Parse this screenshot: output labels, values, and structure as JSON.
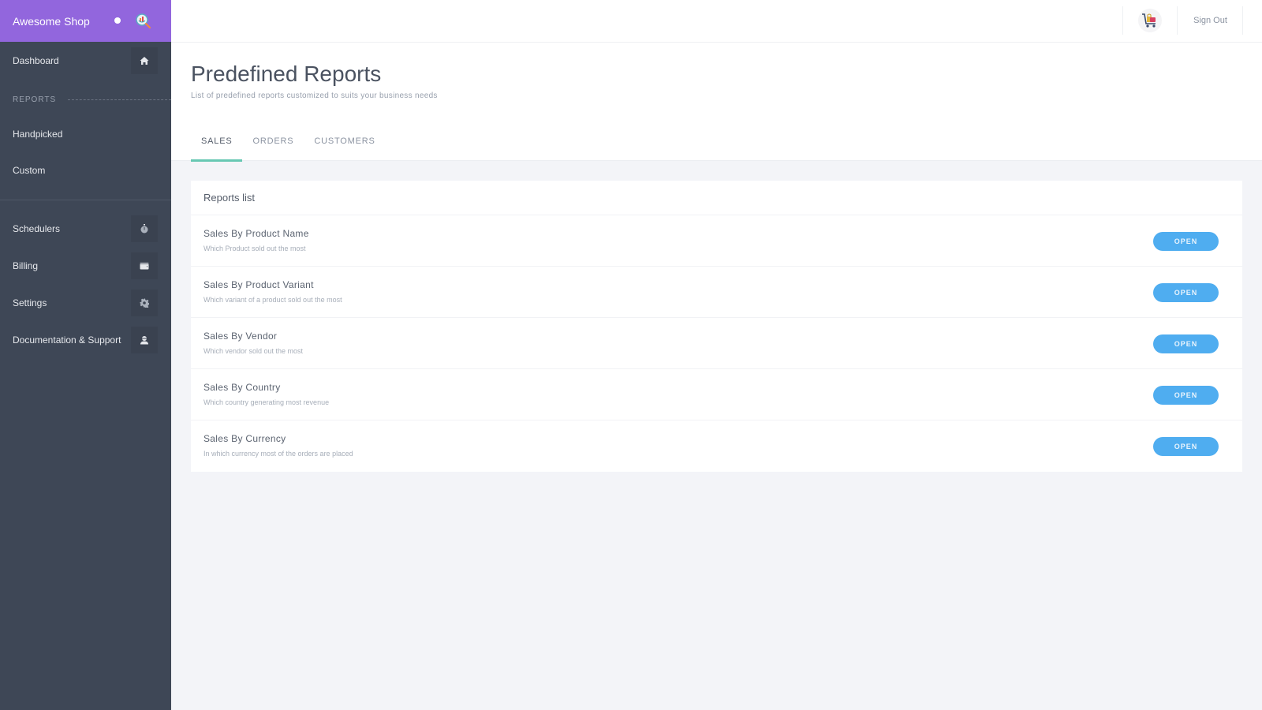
{
  "brand": {
    "name": "Awesome Shop",
    "logo_icon": "search-analytics-logo-icon"
  },
  "sidebar": {
    "top_items": [
      {
        "label": "Dashboard",
        "icon": "home-icon"
      }
    ],
    "section_label": "REPORTS",
    "report_items": [
      {
        "label": "Handpicked"
      },
      {
        "label": "Custom"
      }
    ],
    "bottom_items": [
      {
        "label": "Schedulers",
        "icon": "stopwatch-icon"
      },
      {
        "label": "Billing",
        "icon": "wallet-icon"
      },
      {
        "label": "Settings",
        "icon": "gear-icon"
      },
      {
        "label": "Documentation & Support",
        "icon": "support-agent-icon"
      }
    ]
  },
  "topbar": {
    "cart_icon": "shopping-cart-icon",
    "sign_out_label": "Sign Out"
  },
  "page": {
    "title": "Predefined Reports",
    "subtitle": "List of predefined reports customized to suits your business needs",
    "tabs": [
      {
        "label": "SALES",
        "active": true
      },
      {
        "label": "ORDERS",
        "active": false
      },
      {
        "label": "CUSTOMERS",
        "active": false
      }
    ]
  },
  "reports": {
    "header": "Reports list",
    "open_label": "OPEN",
    "items": [
      {
        "name": "Sales By Product Name",
        "description": "Which Product sold out the most"
      },
      {
        "name": "Sales By Product Variant",
        "description": "Which variant of a product sold out the most"
      },
      {
        "name": "Sales By Vendor",
        "description": "Which vendor sold out the most"
      },
      {
        "name": "Sales By Country",
        "description": "Which country generating most revenue"
      },
      {
        "name": "Sales By Currency",
        "description": "In which currency most of the orders are placed"
      }
    ]
  },
  "colors": {
    "brand": "#9266dd",
    "sidebar": "#3e4756",
    "tab_indicator": "#67c8b3",
    "open_button": "#4fadf0"
  }
}
